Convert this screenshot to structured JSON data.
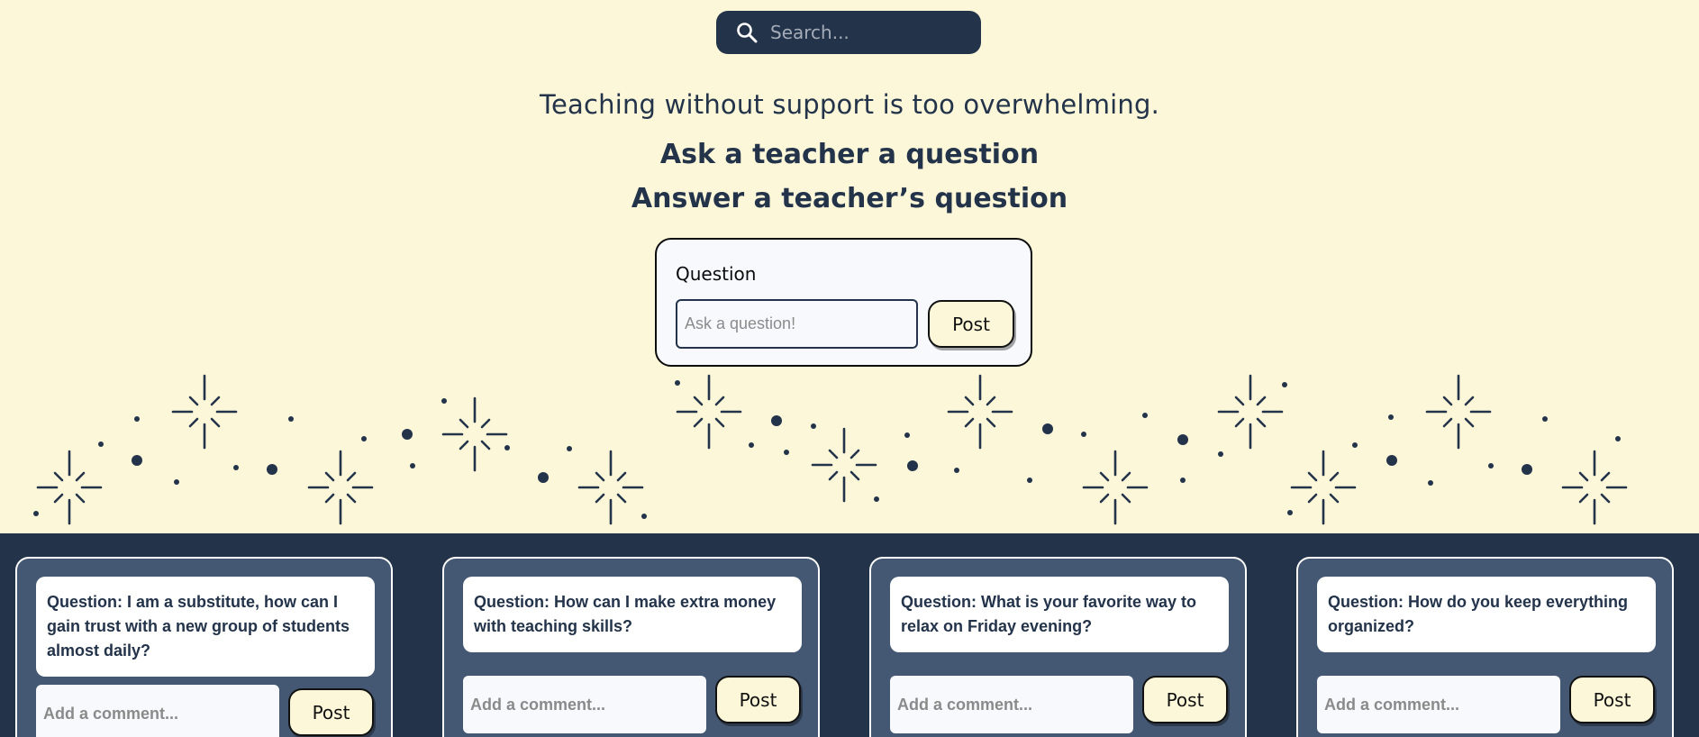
{
  "search": {
    "placeholder": "Search..."
  },
  "hero": {
    "tagline": "Teaching without support is too overwhelming.",
    "line1": "Ask a teacher a question",
    "line2": "Answer a teacher’s question"
  },
  "ask_form": {
    "label": "Question",
    "placeholder": "Ask a question!",
    "post_label": "Post"
  },
  "colors": {
    "cream": "#fcf7d9",
    "navy": "#23334a",
    "card_slate": "#445873"
  },
  "cards": [
    {
      "question": "Question: I am a substitute, how can I gain trust with a new group of students almost daily?",
      "comment_placeholder": "Add a comment...",
      "post_label": "Post"
    },
    {
      "question": "Question: How can I make extra money with teaching skills?",
      "comment_placeholder": "Add a comment...",
      "post_label": "Post"
    },
    {
      "question": "Question: What is your favorite way to relax on Friday evening?",
      "comment_placeholder": "Add a comment...",
      "post_label": "Post"
    },
    {
      "question": "Question: How do you keep everything organized?",
      "comment_placeholder": "Add a comment...",
      "post_label": "Post"
    }
  ]
}
